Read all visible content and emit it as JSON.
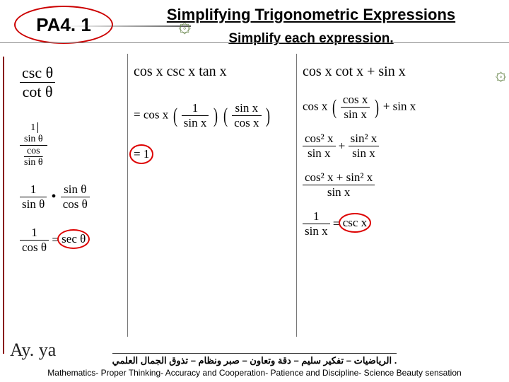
{
  "header": {
    "badge": "PA4. 1",
    "title": "Simplifying Trigonometric Expressions",
    "subtitle": "Simplify each expression."
  },
  "col1": {
    "e1_num": "csc θ",
    "e1_den": "cot θ",
    "e2_num_top": "1",
    "e2_num_bot": "sin θ",
    "e2_den_top": "cos",
    "e2_den_bot": "sin θ",
    "e3a_num": "1",
    "e3a_den": "sin θ",
    "e3b_num": "sin θ",
    "e3b_den": "cos θ",
    "e4_num": "1",
    "e4_den": "cos θ",
    "e4_rhs": "sec θ"
  },
  "col2": {
    "e1": "cos x csc x tan x",
    "e2_lead": "= cos x",
    "e2_p1_num": "1",
    "e2_p1_den": "sin x",
    "e2_p2_num": "sin x",
    "e2_p2_den": "cos x",
    "e3": "= 1"
  },
  "col3": {
    "e1": "cos x cot x + sin x",
    "e2_lead": "cos x",
    "e2_p_num": "cos x",
    "e2_p_den": "sin x",
    "e2_tail": "+ sin x",
    "e3a_num": "cos² x",
    "e3a_den": "sin x",
    "e3b_num": "sin² x",
    "e3b_den": "sin x",
    "e4_num": "cos² x + sin² x",
    "e4_den": "sin x",
    "e5_num": "1",
    "e5_den": "sin x",
    "e5_rhs": "csc x"
  },
  "footer": {
    "arabic": ". الرياضيات – تفكير سليم – دقة وتعاون – صبر ونظام – تذوق الجمال العلمي",
    "english": "Mathematics- Proper Thinking- Accuracy and Cooperation- Patience and Discipline- Science Beauty sensation"
  },
  "signature": "Ay. ya"
}
